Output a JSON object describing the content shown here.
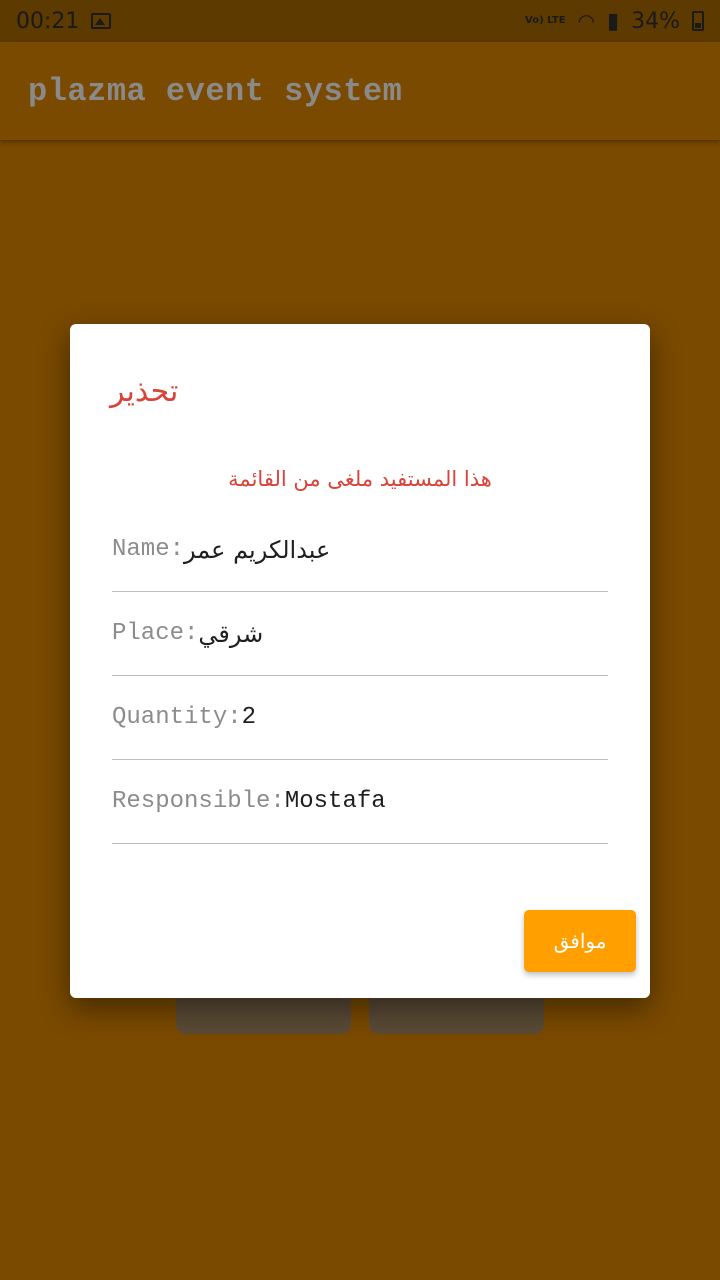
{
  "status_bar": {
    "time": "00:21",
    "network": "Vo) LTE",
    "battery": "34%",
    "icons": [
      "image-icon",
      "volte-icon",
      "wifi-icon",
      "signal-icon",
      "battery-icon"
    ]
  },
  "app_bar": {
    "title": "plazma event system"
  },
  "dialog": {
    "title": "تحذير",
    "message": "هذا المستفيد ملغى من القائمة",
    "fields": [
      {
        "label": "Name:",
        "value": "عبدالكريم عمر"
      },
      {
        "label": "Place:",
        "value": "شرقي"
      },
      {
        "label": "Quantity:",
        "value": "2"
      },
      {
        "label": "Responsible:",
        "value": "Mostafa"
      }
    ],
    "ok_label": "موافق"
  },
  "colors": {
    "background": "#7a4a00",
    "status_bar": "#5c3a00",
    "accent_button": "#ff9f00",
    "warning_text": "#d8443a"
  }
}
